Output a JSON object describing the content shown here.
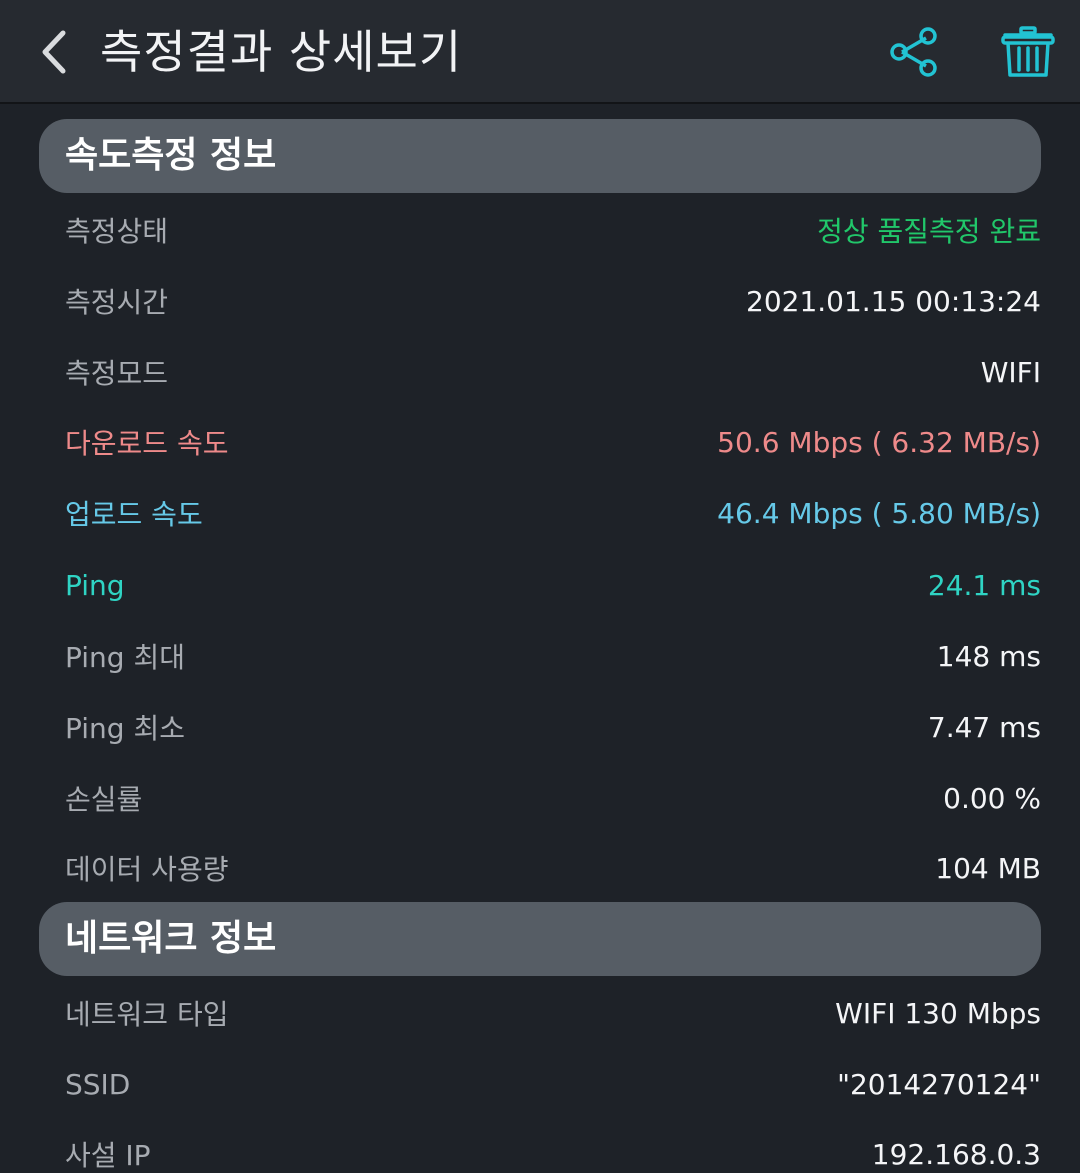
{
  "header": {
    "title": "측정결과 상세보기",
    "icons": {
      "back": "chevron-left-icon",
      "share": "share-icon",
      "delete": "trash-icon"
    },
    "accent_color": "#22c3d3"
  },
  "speed_section": {
    "title": "속도측정 정보",
    "rows": [
      {
        "label": "측정상태",
        "value": "정상 품질측정 완료"
      },
      {
        "label": "측정시간",
        "value": "2021.01.15 00:13:24"
      },
      {
        "label": "측정모드",
        "value": "WIFI"
      },
      {
        "label": "다운로드 속도",
        "value": "50.6 Mbps ( 6.32 MB/s)"
      },
      {
        "label": "업로드 속도",
        "value": "46.4 Mbps ( 5.80 MB/s)"
      },
      {
        "label": "Ping",
        "value": "24.1 ms"
      },
      {
        "label": "Ping 최대",
        "value": "148 ms"
      },
      {
        "label": "Ping 최소",
        "value": "7.47 ms"
      },
      {
        "label": "손실률",
        "value": "0.00 %"
      },
      {
        "label": "데이터 사용량",
        "value": "104 MB"
      }
    ]
  },
  "network_section": {
    "title": "네트워크 정보",
    "rows": [
      {
        "label": "네트워크 타입",
        "value": "WIFI 130 Mbps"
      },
      {
        "label": "SSID",
        "value": "\"2014270124\""
      },
      {
        "label": "사설 IP",
        "value": "192.168.0.3"
      }
    ]
  },
  "colors": {
    "status_ok": "#21c76a",
    "download": "#ee8a8a",
    "upload": "#66c9e8",
    "ping": "#2fd4c4"
  }
}
